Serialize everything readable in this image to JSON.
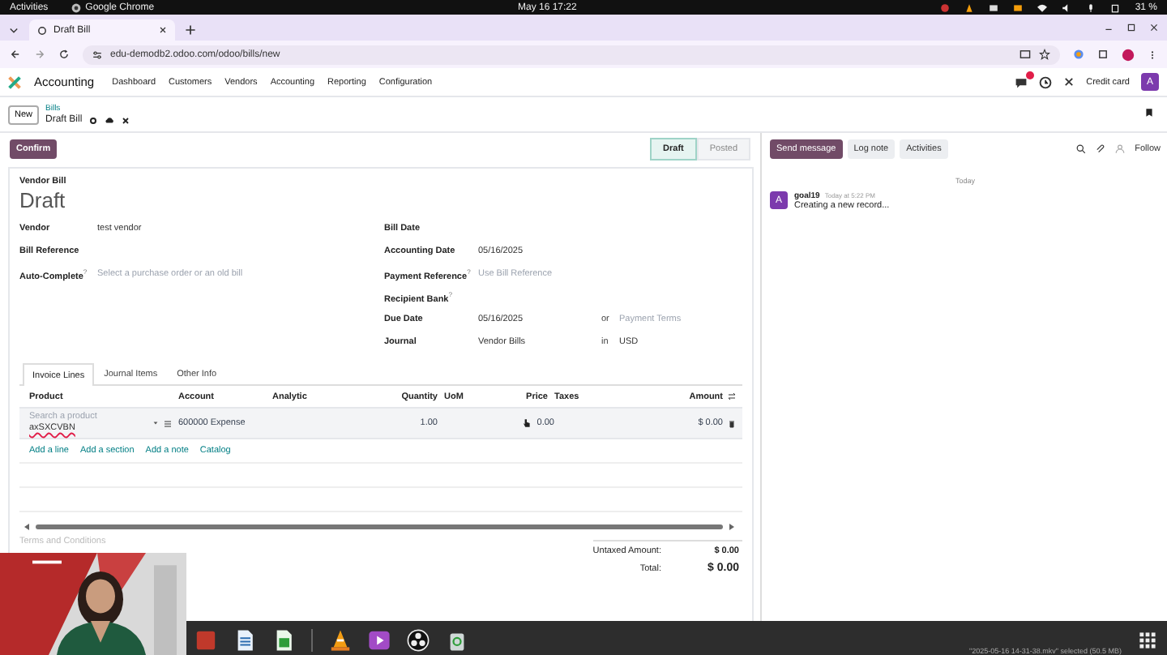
{
  "system_bar": {
    "activities": "Activities",
    "app": "Google Chrome",
    "clock": "May 16  17:22",
    "battery": "31 %"
  },
  "browser": {
    "tabs": [
      {
        "title": "Draft Bill",
        "selected": true
      }
    ],
    "url": "edu-demodb2.odoo.com/odoo/bills/new"
  },
  "app_nav": {
    "app_name": "Accounting",
    "menu": [
      "Dashboard",
      "Customers",
      "Vendors",
      "Accounting",
      "Reporting",
      "Configuration"
    ],
    "company": "Credit card",
    "avatar": "A"
  },
  "breadcrumb": {
    "new_button": "New",
    "parent": "Bills",
    "current": "Draft Bill"
  },
  "actions": {
    "confirm": "Confirm",
    "stages": [
      {
        "label": "Draft",
        "selected": true
      },
      {
        "label": "Posted",
        "selected": false
      }
    ]
  },
  "form": {
    "type_label": "Vendor Bill",
    "title": "Draft",
    "left_fields": [
      {
        "label": "Vendor",
        "value": "test vendor"
      },
      {
        "label": "Bill Reference"
      },
      {
        "label": "Auto-Complete",
        "help": "?",
        "placeholder": "Select a purchase order or an old bill"
      }
    ],
    "right_fields": [
      {
        "label": "Bill Date"
      },
      {
        "label": "Accounting Date",
        "value": "05/16/2025"
      },
      {
        "label": "Payment Reference",
        "help": "?",
        "placeholder": "Use Bill Reference"
      },
      {
        "label": "Recipient Bank",
        "help": "?"
      },
      {
        "label": "Due Date",
        "value": "05/16/2025",
        "joiner": "or",
        "extra_placeholder": "Payment Terms"
      },
      {
        "label": "Journal",
        "value": "Vendor Bills",
        "joiner": "in",
        "extra_value": "USD"
      }
    ],
    "tabs": [
      {
        "label": "Invoice Lines",
        "selected": true
      },
      {
        "label": "Journal Items",
        "selected": false
      },
      {
        "label": "Other Info",
        "selected": false
      }
    ],
    "columns": [
      "Product",
      "Account",
      "Analytic",
      "Quantity",
      "UoM",
      "Price",
      "Taxes",
      "Amount"
    ],
    "rows": [
      {
        "product_placeholder": "Search a product",
        "label_text": "axSXCVBN",
        "account": "600000 Expense",
        "quantity": "1.00",
        "price": "0.00",
        "amount": "$ 0.00"
      }
    ],
    "links": [
      "Add a line",
      "Add a section",
      "Add a note",
      "Catalog"
    ],
    "terms_placeholder": "Terms and Conditions",
    "totals": [
      {
        "label": "Untaxed Amount:",
        "value": "$ 0.00"
      },
      {
        "label": "Total:",
        "value": "$ 0.00"
      }
    ]
  },
  "chatter": {
    "buttons": [
      {
        "label": "Send message",
        "selected": true
      },
      {
        "label": "Log note",
        "selected": false
      },
      {
        "label": "Activities",
        "selected": false
      }
    ],
    "follow": "Follow",
    "day": "Today",
    "messages": [
      {
        "avatar": "A",
        "author": "goal19",
        "time": "Today at 5:22 PM",
        "text": "Creating a new record..."
      }
    ]
  },
  "taskbar": {
    "status": "\"2025-05-16 14-31-38.mkv\" selected (50.5 MB)"
  }
}
